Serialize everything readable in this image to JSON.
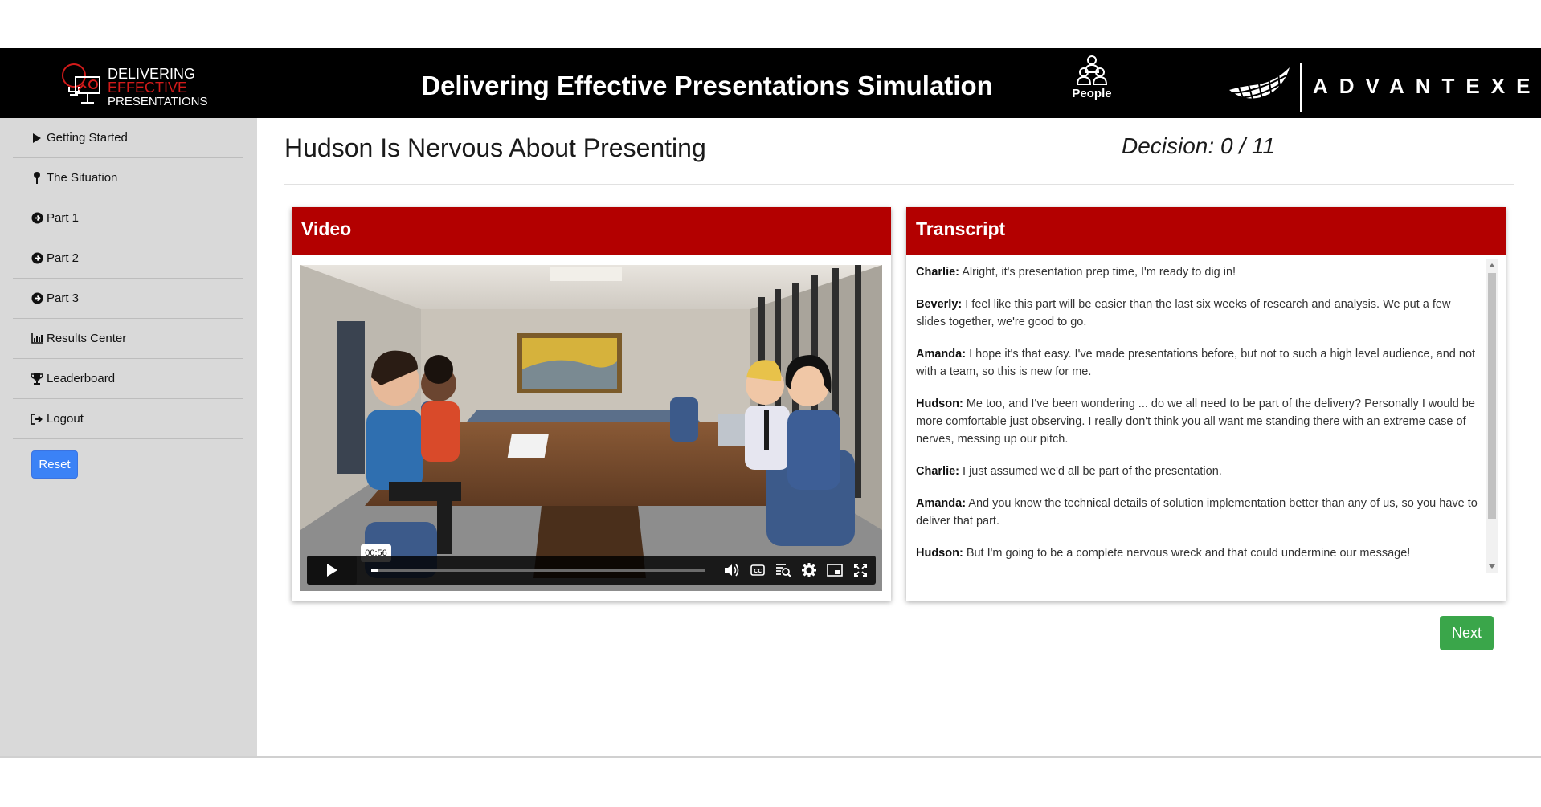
{
  "header": {
    "logo_lines": [
      "DELIVERING",
      "EFFECTIVE",
      "PRESENTATIONS"
    ],
    "title": "Delivering Effective Presentations Simulation",
    "people_label": "People",
    "brand": "ADVANTEXE"
  },
  "sidebar": {
    "items": [
      {
        "label": "Getting Started",
        "icon": "play-icon"
      },
      {
        "label": "The Situation",
        "icon": "pin-icon"
      },
      {
        "label": "Part 1",
        "icon": "arrow-circle-right-icon"
      },
      {
        "label": "Part 2",
        "icon": "arrow-circle-right-icon"
      },
      {
        "label": "Part 3",
        "icon": "arrow-circle-right-icon"
      },
      {
        "label": "Results Center",
        "icon": "bar-chart-icon"
      },
      {
        "label": "Leaderboard",
        "icon": "trophy-icon"
      },
      {
        "label": "Logout",
        "icon": "sign-out-icon"
      }
    ],
    "reset_label": "Reset"
  },
  "main": {
    "page_title": "Hudson Is Nervous About Presenting",
    "decision": "Decision: 0 / 11",
    "video": {
      "heading": "Video",
      "time_tooltip": "00:56",
      "progress_fraction": 0.02
    },
    "transcript": {
      "heading": "Transcript",
      "lines": [
        {
          "speaker": "Charlie:",
          "text": " Alright, it's presentation prep time, I'm ready to dig in!"
        },
        {
          "speaker": "Beverly:",
          "text": " I feel like this part will be easier than the last six weeks of research and analysis. We put a few slides together, we're good to go."
        },
        {
          "speaker": "Amanda:",
          "text": " I hope it's that easy. I've made presentations before, but not to such a high level audience, and not with a team, so this is new for me."
        },
        {
          "speaker": "Hudson:",
          "text": " Me too, and I've been wondering ... do we all need to be part of the delivery? Personally I would be more comfortable just observing. I really don't think you all want me standing there with an extreme case of nerves, messing up our pitch."
        },
        {
          "speaker": "Charlie:",
          "text": " I just assumed we'd all be part of the presentation."
        },
        {
          "speaker": "Amanda:",
          "text": " And you know the technical details of solution implementation better than any of us, so you have to deliver that part."
        },
        {
          "speaker": "Hudson:",
          "text": " But I'm going to be a complete nervous wreck and that could undermine our message!"
        }
      ]
    },
    "next_label": "Next"
  },
  "colors": {
    "header_bg": "#000000",
    "card_header": "#b30000",
    "sidebar_bg": "#d9d9d9",
    "reset_button": "#3b82f6",
    "next_button": "#3aa64a"
  }
}
